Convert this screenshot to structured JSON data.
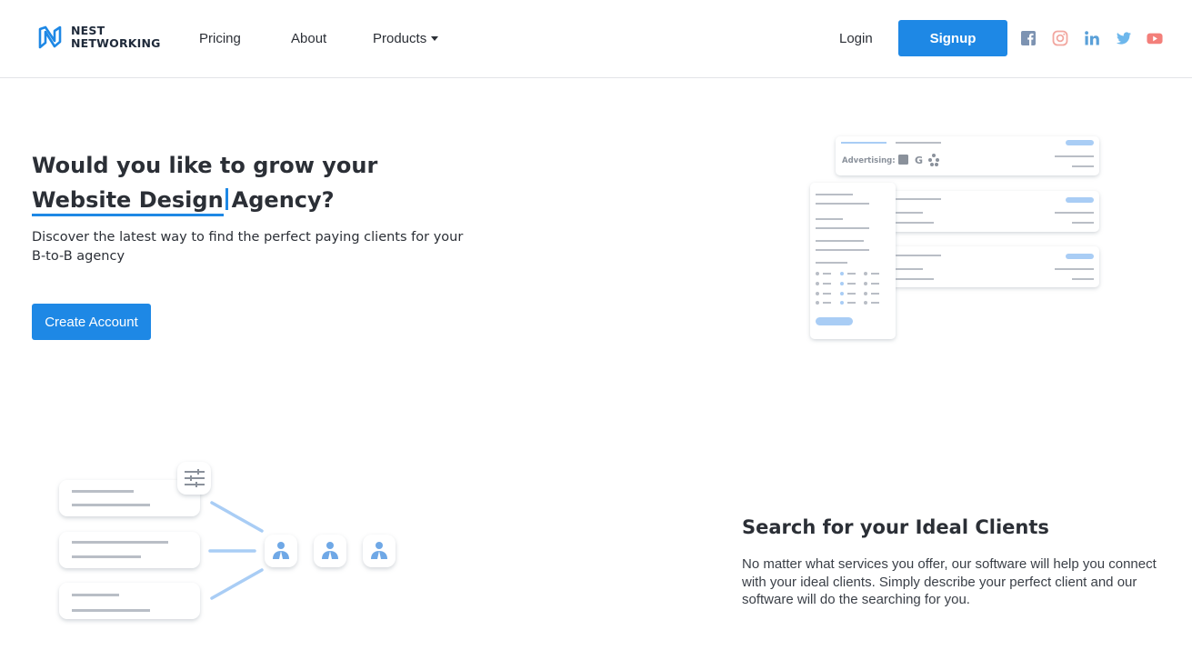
{
  "header": {
    "logo": {
      "line1": "NEST",
      "line2": "NETWORKING",
      "icon": "nest-logo-icon"
    },
    "nav": {
      "pricing": "Pricing",
      "about": "About",
      "products": "Products"
    },
    "login_label": "Login",
    "signup_label": "Signup",
    "social": [
      "facebook-icon",
      "instagram-icon",
      "linkedin-icon",
      "twitter-icon",
      "youtube-icon"
    ]
  },
  "hero": {
    "line1": "Would you like to grow your",
    "typed_word": "Website Design",
    "line2_rest": "Agency?",
    "subtitle": "Discover the latest way to find the perfect paying clients for your B-to-B agency",
    "cta_label": "Create Account"
  },
  "illustration_ads": {
    "advertising_label": "Advertising:"
  },
  "feature": {
    "title": "Search for your Ideal Clients",
    "text": "No matter what services you offer, our software will help you connect with your ideal clients. Simply describe your perfect client and our software will do the searching for you."
  },
  "colors": {
    "accent": "#1e88e5",
    "text": "#2b2f36",
    "light_blue": "#a9cdf5",
    "grey_line": "#b9bec6"
  }
}
